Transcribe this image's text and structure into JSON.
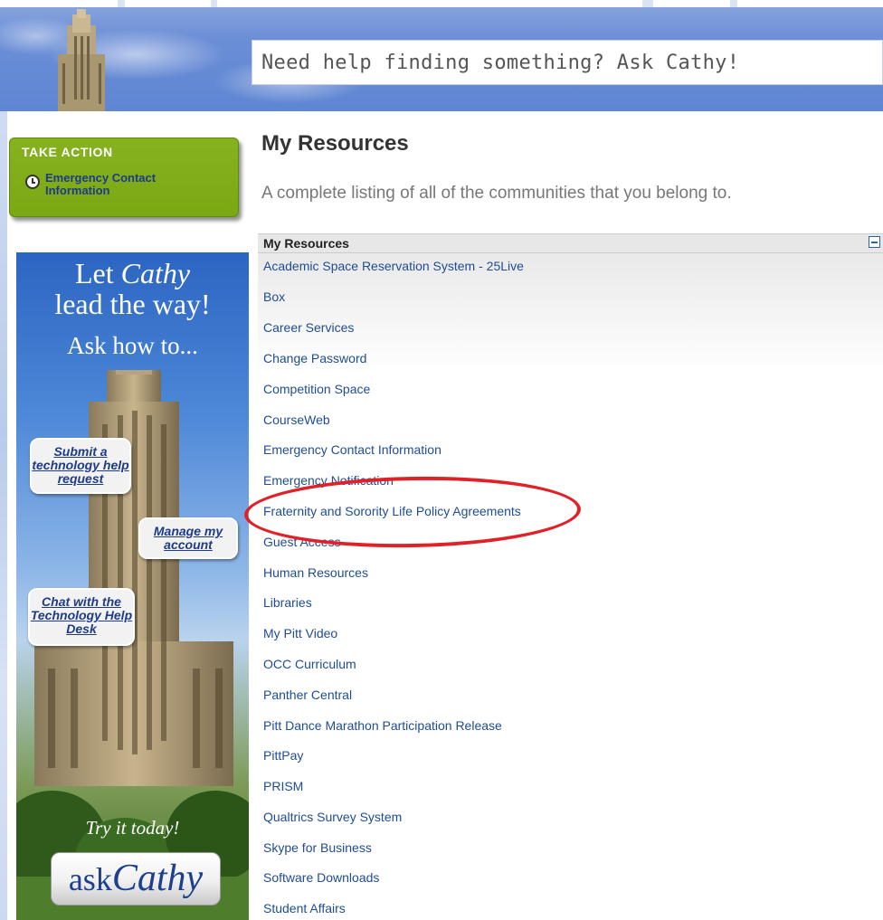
{
  "header": {
    "ask_placeholder": "Need help finding something? Ask Cathy!"
  },
  "take_action": {
    "title": "TAKE ACTION",
    "item_icon": "clock-icon",
    "item_label": "Emergency Contact Information"
  },
  "ad": {
    "line1_a": "Let ",
    "line1_b": "Cathy",
    "line2": "lead the way!",
    "line3": "Ask how to...",
    "bubbles": {
      "submit": "Submit a technology help request",
      "manage": "Manage my account",
      "chat": "Chat with the Technology Help Desk"
    },
    "try_it": "Try it today!",
    "logo_ask": "ask",
    "logo_cathy": "Cathy"
  },
  "main": {
    "title": "My Resources",
    "subtitle": "A complete listing of all of the communities that you belong to.",
    "panel_header": "My Resources",
    "collapse_icon": "minus-square-icon",
    "resources": [
      "Academic Space Reservation System - 25Live",
      "Box",
      "Career Services",
      "Change Password",
      "Competition Space",
      "CourseWeb",
      "Emergency Contact Information",
      "Emergency Notification",
      "Fraternity and Sorority Life Policy Agreements",
      "Guest Access",
      "Human Resources",
      "Libraries",
      "My Pitt Video",
      "OCC Curriculum",
      "Panther Central",
      "Pitt Dance Marathon Participation Release",
      "PittPay",
      "PRISM",
      "Qualtrics Survey System",
      "Skype for Business",
      "Software Downloads",
      "Student Affairs"
    ]
  },
  "colors": {
    "link": "#1f4c93",
    "take_action_bg": "#7aa813",
    "banner_blue": "#5f86d3",
    "highlight_red": "#e02127"
  }
}
